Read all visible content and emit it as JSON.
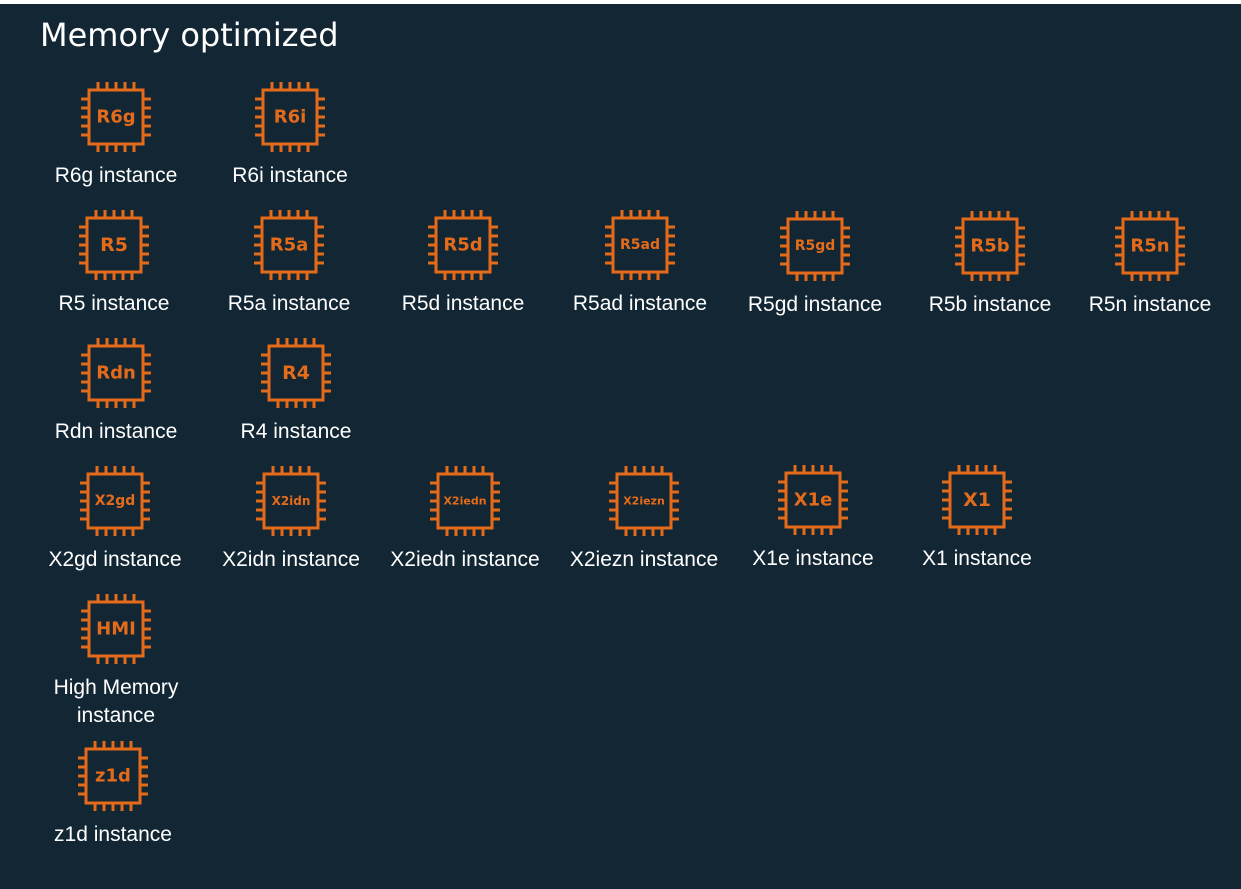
{
  "page": {
    "title": "Memory optimized"
  },
  "colors": {
    "background": "#132634",
    "accent": "#e46b1a",
    "text": "#ffffff"
  },
  "icon": "cpu-chip-icon",
  "instances": [
    {
      "chip": "R6g",
      "label": "R6g instance"
    },
    {
      "chip": "R6i",
      "label": "R6i instance"
    },
    {
      "chip": "R5",
      "label": "R5 instance"
    },
    {
      "chip": "R5a",
      "label": "R5a instance"
    },
    {
      "chip": "R5d",
      "label": "R5d instance"
    },
    {
      "chip": "R5ad",
      "label": "R5ad instance"
    },
    {
      "chip": "R5gd",
      "label": "R5gd instance"
    },
    {
      "chip": "R5b",
      "label": "R5b instance"
    },
    {
      "chip": "R5n",
      "label": "R5n instance"
    },
    {
      "chip": "Rdn",
      "label": "Rdn instance"
    },
    {
      "chip": "R4",
      "label": "R4 instance"
    },
    {
      "chip": "X2gd",
      "label": "X2gd instance"
    },
    {
      "chip": "X2idn",
      "label": "X2idn instance"
    },
    {
      "chip": "X2iedn",
      "label": "X2iedn instance"
    },
    {
      "chip": "X2iezn",
      "label": "X2iezn instance"
    },
    {
      "chip": "X1e",
      "label": "X1e instance"
    },
    {
      "chip": "X1",
      "label": "X1 instance"
    },
    {
      "chip": "HMI",
      "label": "High Memory instance"
    },
    {
      "chip": "z1d",
      "label": "z1d instance"
    }
  ]
}
